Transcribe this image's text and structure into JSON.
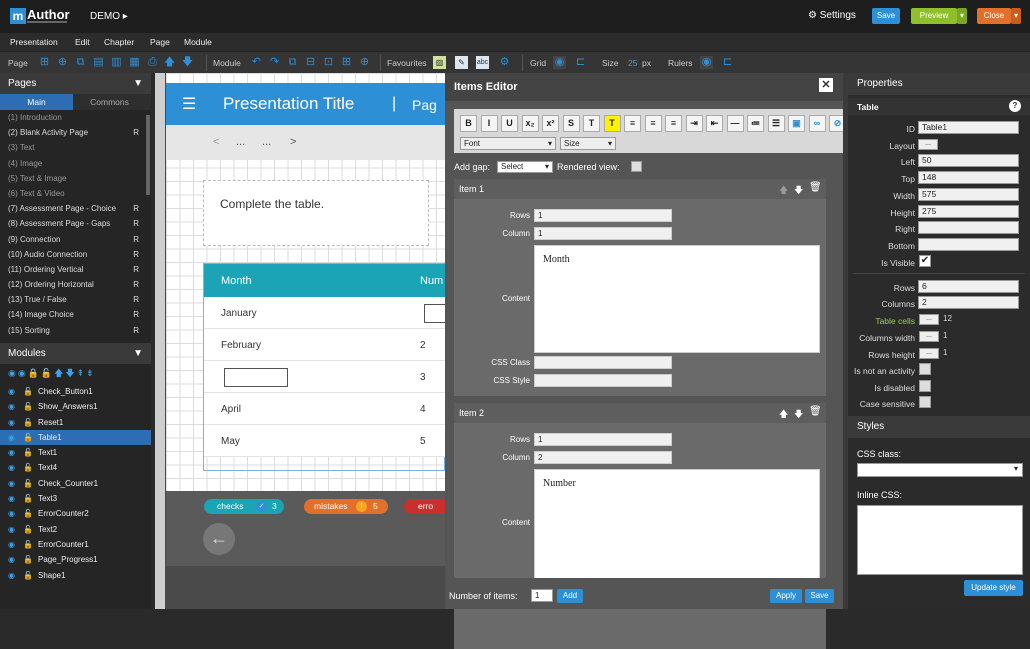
{
  "app": {
    "logo_m": "m",
    "logo_text": "Author",
    "project": "DEMO",
    "settings_label": "Settings",
    "save_label": "Save",
    "preview_label": "Preview",
    "close_label": "Close"
  },
  "menu": [
    "Presentation",
    "Edit",
    "Chapter",
    "Page",
    "Module"
  ],
  "toolbar": {
    "page_label": "Page",
    "module_label": "Module",
    "favourites_label": "Favourites",
    "grid_label": "Grid",
    "size_label": "Size",
    "size_value": "25",
    "size_unit": "px",
    "rulers_label": "Rulers"
  },
  "pages": {
    "title": "Pages",
    "tab_main": "Main",
    "tab_commons": "Commons",
    "items": [
      {
        "label": "(1) Introduction",
        "dim": true,
        "r": ""
      },
      {
        "label": "(2) Blank Activity Page",
        "dim": false,
        "r": "R"
      },
      {
        "label": "(3) Text",
        "dim": true,
        "r": ""
      },
      {
        "label": "(4) Image",
        "dim": true,
        "r": ""
      },
      {
        "label": "(5) Text & Image",
        "dim": true,
        "r": ""
      },
      {
        "label": "(6) Text & Video",
        "dim": true,
        "r": ""
      },
      {
        "label": "(7) Assessment Page - Choice",
        "dim": false,
        "r": "R"
      },
      {
        "label": "(8) Assessment Page - Gaps",
        "dim": false,
        "r": "R"
      },
      {
        "label": "(9) Connection",
        "dim": false,
        "r": "R"
      },
      {
        "label": "(10) Audio Connection",
        "dim": false,
        "r": "R"
      },
      {
        "label": "(11) Ordering Vertical",
        "dim": false,
        "r": "R"
      },
      {
        "label": "(12) Ordering Horizontal",
        "dim": false,
        "r": "R"
      },
      {
        "label": "(13) True / False",
        "dim": false,
        "r": "R"
      },
      {
        "label": "(14) Image Choice",
        "dim": false,
        "r": "R"
      },
      {
        "label": "(15) Sorting",
        "dim": false,
        "r": "R"
      }
    ]
  },
  "modules": {
    "title": "Modules",
    "items": [
      "Check_Button1",
      "Show_Answers1",
      "Reset1",
      "Table1",
      "Text1",
      "Text4",
      "Check_Counter1",
      "Text3",
      "ErrorCounter2",
      "Text2",
      "ErrorCounter1",
      "Page_Progress1",
      "Shape1"
    ],
    "selected_index": 3
  },
  "slide": {
    "title": "Presentation Title",
    "page_partial": "Pag",
    "nav_prev": "<",
    "nav_dots1": "...",
    "nav_dots2": "...",
    "nav_next": ">",
    "instruction": "Complete the table.",
    "col1_header": "Month",
    "col2_header": "Num",
    "rows": [
      {
        "month": "January",
        "num": ""
      },
      {
        "month": "February",
        "num": "2"
      },
      {
        "month": "",
        "num": "3"
      },
      {
        "month": "April",
        "num": "4"
      },
      {
        "month": "May",
        "num": "5"
      }
    ],
    "checks_label": "checks",
    "checks_count": "3",
    "mistakes_label": "mistakes",
    "mistakes_count": "5",
    "errors_partial": "erro"
  },
  "items_editor": {
    "title": "Items Editor",
    "font_select": "Font",
    "size_select": "Size",
    "add_gap_label": "Add gap:",
    "add_gap_select": "Select",
    "rendered_view_label": "Rendered view:",
    "rows_label": "Rows",
    "column_label": "Column",
    "content_label": "Content",
    "css_class_label": "CSS Class",
    "css_style_label": "CSS Style",
    "items": [
      {
        "title": "Item 1",
        "rows": "1",
        "column": "1",
        "content": "Month"
      },
      {
        "title": "Item 2",
        "rows": "1",
        "column": "2",
        "content": "Number"
      }
    ],
    "number_of_items_label": "Number of items:",
    "number_of_items_value": "1",
    "add_label": "Add",
    "apply_label": "Apply",
    "save_label": "Save"
  },
  "properties": {
    "title": "Properties",
    "section": "Table",
    "id_label": "ID",
    "id_value": "Table1",
    "layout_label": "Layout",
    "left_label": "Left",
    "left_value": "50",
    "top_label": "Top",
    "top_value": "148",
    "width_label": "Width",
    "width_value": "575",
    "height_label": "Height",
    "height_value": "275",
    "right_label": "Right",
    "bottom_label": "Bottom",
    "visible_label": "Is Visible",
    "rows_label": "Rows",
    "rows_value": "6",
    "columns_label": "Columns",
    "columns_value": "2",
    "table_cells_label": "Table cells",
    "table_cells_count": "12",
    "columns_width_label": "Columns width",
    "columns_width_count": "1",
    "rows_height_label": "Rows height",
    "rows_height_count": "1",
    "not_activity_label": "Is not an activity",
    "disabled_label": "Is disabled",
    "case_label": "Case sensitive",
    "styles_title": "Styles",
    "css_class_label": "CSS class:",
    "inline_css_label": "Inline CSS:",
    "update_style_label": "Update style",
    "dots": "..."
  },
  "colors": {
    "accent": "#2d8fd6",
    "preview": "#8fbf2a",
    "close": "#e3702a",
    "teal": "#1ba4b5"
  }
}
